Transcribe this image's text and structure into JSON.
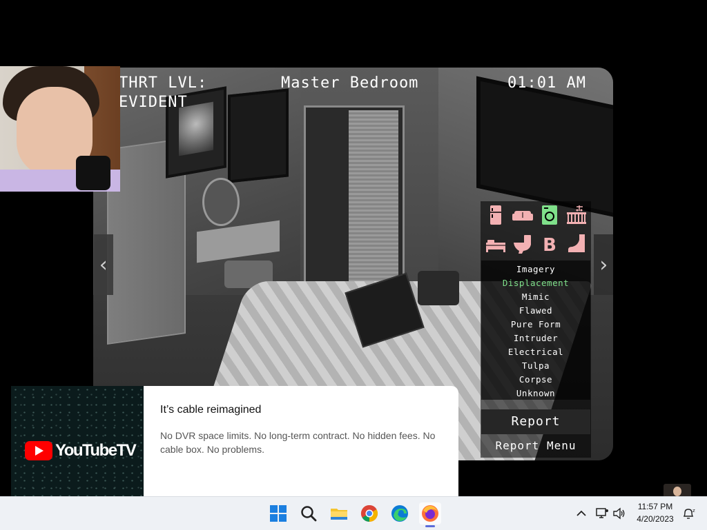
{
  "game": {
    "threat_label": "THRT LVL:",
    "threat_value": "EVIDENT",
    "room_name": "Master Bedroom",
    "clock": "01:01 AM",
    "nav_prev": "‹",
    "nav_next": "›",
    "category_icons": [
      {
        "name": "fridge",
        "color": "#f3b1b3"
      },
      {
        "name": "couch",
        "color": "#f3b1b3"
      },
      {
        "name": "washing-machine",
        "color": "#7fe08a"
      },
      {
        "name": "crib",
        "color": "#f3b1b3"
      },
      {
        "name": "bed",
        "color": "#f3b1b3"
      },
      {
        "name": "toilet",
        "color": "#f3b1b3"
      },
      {
        "name": "bold-b",
        "color": "#f3b1b3"
      },
      {
        "name": "boot",
        "color": "#f3b1b3"
      }
    ],
    "anomaly_types": [
      {
        "label": "Imagery",
        "color": "#ffffff"
      },
      {
        "label": "Displacement",
        "color": "#7fe08a"
      },
      {
        "label": "Mimic",
        "color": "#ffffff"
      },
      {
        "label": "Flawed",
        "color": "#ffffff"
      },
      {
        "label": "Pure Form",
        "color": "#ffffff"
      },
      {
        "label": "Intruder",
        "color": "#ffffff"
      },
      {
        "label": "Electrical",
        "color": "#ffffff"
      },
      {
        "label": "Tulpa",
        "color": "#ffffff"
      },
      {
        "label": "Corpse",
        "color": "#ffffff"
      },
      {
        "label": "Unknown",
        "color": "#ffffff"
      }
    ],
    "report_label": "Report",
    "report_menu_label": "Report Menu"
  },
  "ad": {
    "logo_text": "YouTubeTV",
    "title": "It’s cable reimagined",
    "body": "No DVR space limits. No long-term contract. No hidden fees. No cable box. No problems."
  },
  "taskbar": {
    "apps": [
      "start",
      "search",
      "file-explorer",
      "chrome",
      "edge",
      "firefox"
    ],
    "active_app": "firefox",
    "time": "11:57 PM",
    "date": "4/20/2023"
  }
}
